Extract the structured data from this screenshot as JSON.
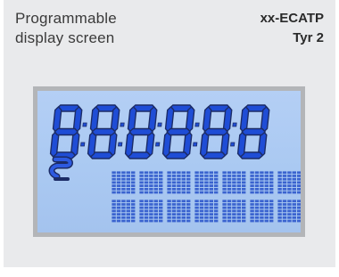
{
  "header": {
    "title_line1": "Programmable",
    "title_line2": "display screen",
    "model_line1": "xx-ECATP",
    "model_line2": "Tyr 2"
  },
  "display": {
    "digit_count": 6,
    "matrix_rows": 2,
    "matrix_cols": 7,
    "colors": {
      "lcd_background": "#aecbf3",
      "segment": "#1f4dd6",
      "segment_outline": "#1c2c66",
      "frame": "#b3b5b8"
    },
    "icons": [
      "s-swirl-icon"
    ]
  }
}
